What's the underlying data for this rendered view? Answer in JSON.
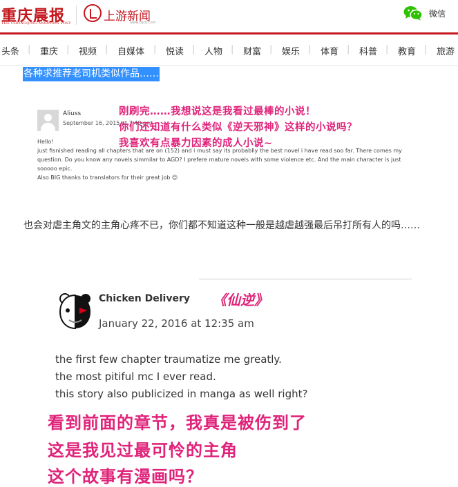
{
  "header": {
    "logo_cq": "重庆晨报",
    "logo_cq_en": "THE CHONGQING MORNING POST",
    "logo_sy": "上游新闻",
    "logo_sy_url": "www.cqcb.com",
    "wechat_label": "微信"
  },
  "nav": {
    "items": [
      "头条",
      "重庆",
      "视频",
      "自媒体",
      "悦读",
      "人物",
      "财富",
      "娱乐",
      "体育",
      "科普",
      "教育",
      "旅游"
    ]
  },
  "article": {
    "highlighted_title": "各种求推荐老司机类似作品……",
    "screenshot1": {
      "name": "Aliuss",
      "date": "September 16, 2015 at 7:48 pm",
      "lines": [
        "Hello!",
        "just fisnished reading all chapters that are on (152) and i must say its probablly the best novel i have read soo far. There comes my",
        "question. Do you know any novels simmilar to AGD? I prefere mature novels with some violence etc. And the main character is just",
        "sooooo epic.",
        "Also BIG thanks to translators for their great job 😊"
      ],
      "annotations": [
        "刚刷完……我想说这是我看过最棒的小说！",
        "你们还知道有什么类似《逆天邪神》这样的小说吗？",
        "我喜欢有点暴力因素的成人小说~"
      ]
    },
    "paragraph1": "也会对虐主角文的主角心疼不已，你们都不知道这种一般是越虐越强最后吊打所有人的吗……",
    "screenshot2": {
      "name": "Chicken Delivery",
      "novel": "《仙逆》",
      "date": "January 22, 2016 at 12:35 am",
      "lines": [
        "the first few chapter traumatize me greatly.",
        "the most pitiful mc I ever read.",
        "this story also publicized in manga as well right?"
      ],
      "annotations": [
        "看到前面的章节，我真是被伤到了",
        "这是我见过最可怜的主角",
        "这个故事有漫画吗？"
      ]
    }
  },
  "colors": {
    "brand_red": "#c4161c",
    "annotation_pink": "#e0237a",
    "selection_blue": "#3390ff",
    "wechat_green": "#2dc100"
  },
  "icons": {
    "wechat": "wechat-icon",
    "logo_mark": "shangyou-logo-icon"
  }
}
